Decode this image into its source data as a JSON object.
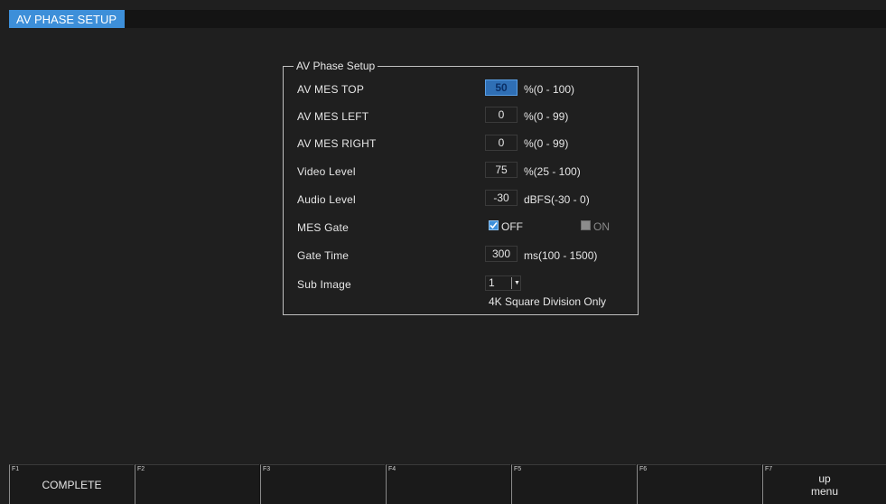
{
  "header": {
    "title": "AV PHASE SETUP"
  },
  "panel": {
    "legend": "AV Phase Setup",
    "rows": [
      {
        "label": "AV MES TOP",
        "value": "50",
        "unit": "%(0 - 100)"
      },
      {
        "label": "AV MES LEFT",
        "value": "0",
        "unit": "%(0 - 99)"
      },
      {
        "label": "AV MES RIGHT",
        "value": "0",
        "unit": "%(0 - 99)"
      },
      {
        "label": "Video Level",
        "value": "75",
        "unit": "%(25 - 100)"
      },
      {
        "label": "Audio Level",
        "value": "-30",
        "unit": "dBFS(-30 - 0)"
      },
      {
        "label": "Gate Time",
        "value": "300",
        "unit": "ms(100 - 1500)"
      }
    ],
    "mes_gate": {
      "label": "MES Gate",
      "off_label": "OFF",
      "on_label": "ON"
    },
    "sub_image": {
      "label": "Sub Image",
      "value": "1",
      "arrow": "▼",
      "note": "4K Square Division Only"
    }
  },
  "fkeys": [
    {
      "num": "F1",
      "label": "COMPLETE"
    },
    {
      "num": "F2",
      "label": ""
    },
    {
      "num": "F3",
      "label": ""
    },
    {
      "num": "F4",
      "label": ""
    },
    {
      "num": "F5",
      "label": ""
    },
    {
      "num": "F6",
      "label": ""
    },
    {
      "num": "F7",
      "label": "up\nmenu"
    }
  ]
}
